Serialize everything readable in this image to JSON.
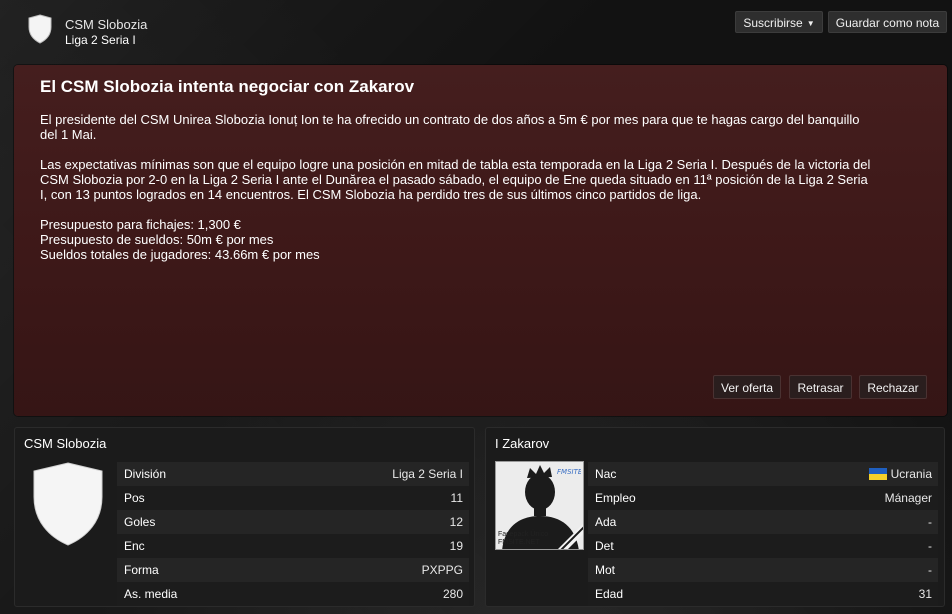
{
  "header": {
    "club_name": "CSM Slobozia",
    "league_name": "Liga 2 Seria I",
    "subscribe_label": "Suscribirse",
    "save_note_label": "Guardar como nota",
    "club_icon": "shield-icon"
  },
  "message": {
    "title": "El CSM Slobozia intenta negociar con Zakarov",
    "p1": [
      "El presidente del CSM Unirea Slobozia Ionuț Ion te ha ofrecido un contrato de dos años a 5m € por mes para que te hagas cargo del banquillo",
      "del 1 Mai."
    ],
    "p2": [
      "Las expectativas mínimas son que el equipo logre una posición en mitad de tabla esta temporada en la Liga 2 Seria I. Después de la victoria del",
      "CSM Slobozia por 2-0 en la Liga 2 Seria I ante el Dunărea el pasado sábado, el equipo de Ene queda situado en 11ª posición de la Liga 2 Seria",
      "I, con 13 puntos logrados en 14 encuentros. El CSM Slobozia ha perdido tres de sus últimos cinco partidos de liga."
    ],
    "p3": [
      "Presupuesto para fichajes: 1,300 €",
      "Presupuesto de sueldos: 50m € por mes",
      "Sueldos totales de jugadores: 43.66m € por mes"
    ],
    "buttons": {
      "view_offer": "Ver oferta",
      "delay": "Retrasar",
      "reject": "Rechazar"
    }
  },
  "club_card": {
    "title": "CSM Slobozia",
    "rows": [
      {
        "label": "División",
        "value": "Liga 2 Seria I"
      },
      {
        "label": "Pos",
        "value": "11"
      },
      {
        "label": "Goles",
        "value": "12"
      },
      {
        "label": "Enc",
        "value": "19"
      },
      {
        "label": "Forma",
        "value": "PXPPG"
      },
      {
        "label": "As. media",
        "value": "280"
      }
    ]
  },
  "manager_card": {
    "title": "I Zakarov",
    "photo_caption": [
      "Facepack Único",
      "FMSITE.NET"
    ],
    "photo_badge": "FMSITE",
    "rows": [
      {
        "label": "Nac",
        "value": "Ucrania",
        "icon": "ukraine-flag-icon"
      },
      {
        "label": "Empleo",
        "value": "Mánager"
      },
      {
        "label": "Ada",
        "value": "-"
      },
      {
        "label": "Det",
        "value": "-"
      },
      {
        "label": "Mot",
        "value": "-"
      },
      {
        "label": "Edad",
        "value": "31"
      }
    ]
  },
  "colors": {
    "panel": "#451e1e",
    "flag_blue": "#1f5fbf",
    "flag_yellow": "#f4d12a"
  }
}
